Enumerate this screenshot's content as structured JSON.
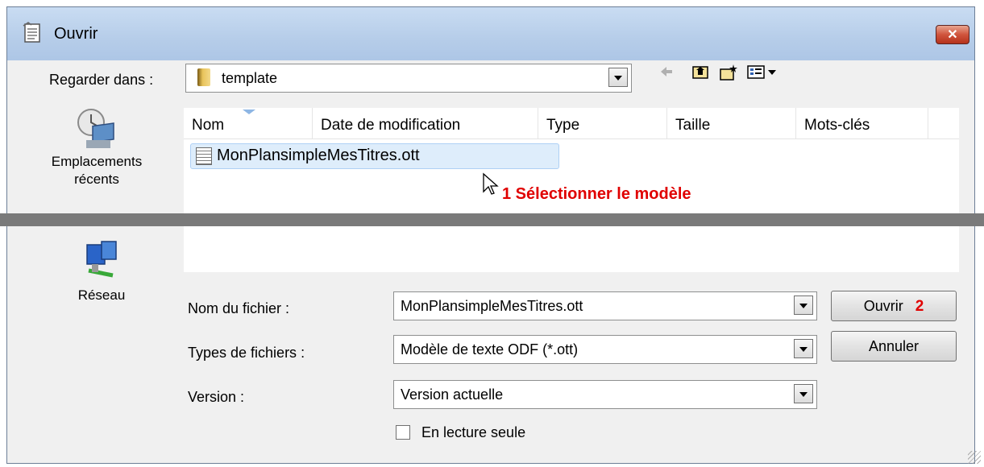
{
  "window": {
    "title": "Ouvrir",
    "close_label": "✕"
  },
  "lookin": {
    "label": "Regarder dans :",
    "value": "template"
  },
  "toolbar": {
    "icons": [
      "back-icon",
      "up-folder-icon",
      "new-folder-icon",
      "view-menu-icon"
    ]
  },
  "places": [
    {
      "label_line1": "Emplacements",
      "label_line2": "récents",
      "icon": "recent-places-icon"
    },
    {
      "label_line1": "Réseau",
      "icon": "network-icon"
    }
  ],
  "columns": [
    "Nom",
    "Date de modification",
    "Type",
    "Taille",
    "Mots-clés"
  ],
  "files": [
    {
      "name": "MonPlansimpleMesTitres.ott"
    }
  ],
  "annotations": {
    "step1": "1 Sélectionner le modèle",
    "step2": "2"
  },
  "fields": {
    "filename": {
      "label": "Nom du fichier :",
      "value": "MonPlansimpleMesTitres.ott"
    },
    "filetype": {
      "label": "Types de fichiers :",
      "value": "Modèle de texte ODF (*.ott)"
    },
    "version": {
      "label": "Version :",
      "value": "Version actuelle"
    }
  },
  "buttons": {
    "open": "Ouvrir",
    "cancel": "Annuler"
  },
  "readonly": {
    "label": "En lecture seule",
    "checked": false
  },
  "colors": {
    "accent": "#e00000",
    "selection": "#deedfb",
    "titlebar": "#b6cde9"
  }
}
